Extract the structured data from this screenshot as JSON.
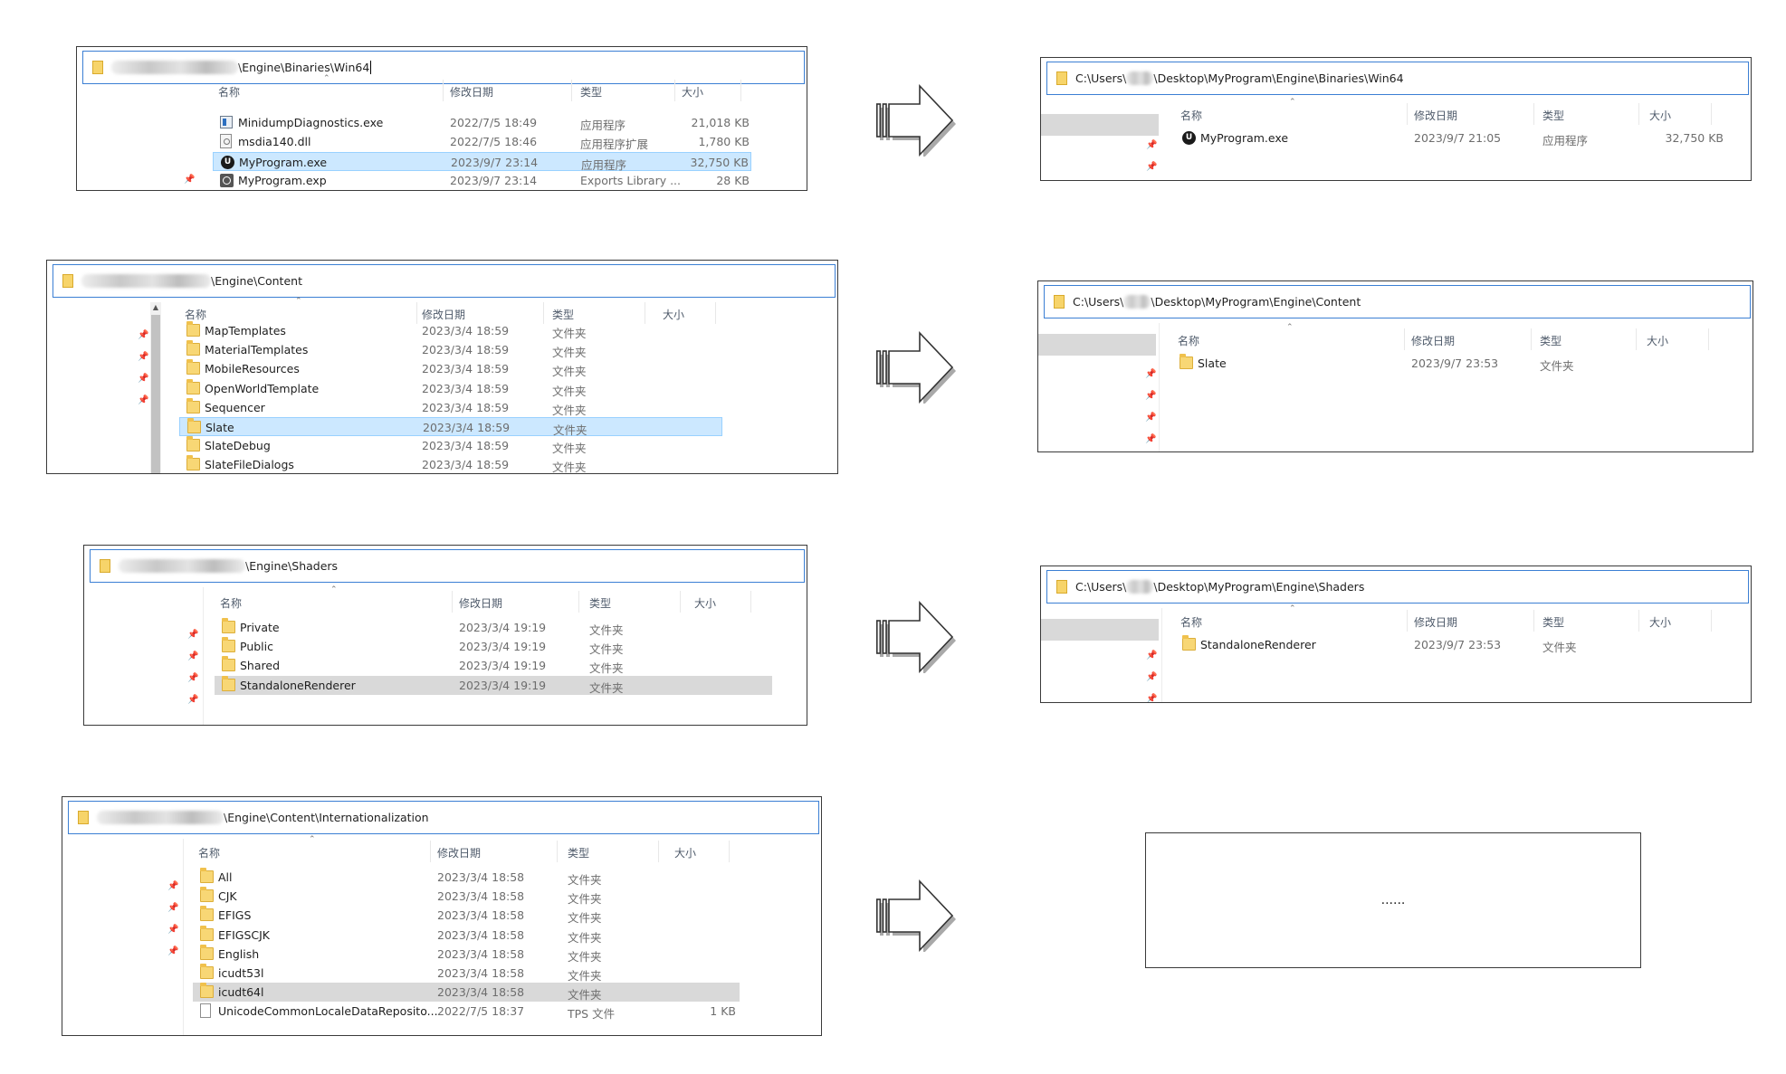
{
  "columns": {
    "name": "名称",
    "date": "修改日期",
    "type": "类型",
    "size": "大小"
  },
  "panels": [
    {
      "id": "p1",
      "path_suffix": "\\Engine\\Binaries\\Win64",
      "rows": [
        {
          "icon": "minidump-app-icon",
          "name": "MinidumpDiagnostics.exe",
          "date": "2022/7/5 18:49",
          "type": "应用程序",
          "size": "21,018 KB"
        },
        {
          "icon": "dll-icon",
          "name": "msdia140.dll",
          "date": "2022/7/5 18:46",
          "type": "应用程序扩展",
          "size": "1,780 KB"
        },
        {
          "icon": "unreal-exe-icon",
          "name": "MyProgram.exe",
          "date": "2023/9/7 23:14",
          "type": "应用程序",
          "size": "32,750 KB"
        },
        {
          "icon": "exp-file-icon",
          "name": "MyProgram.exp",
          "date": "2023/9/7 23:14",
          "type": "Exports Library ...",
          "size": "28 KB"
        }
      ]
    },
    {
      "id": "p2",
      "path_suffix": "\\Engine\\Content",
      "rows": [
        {
          "icon": "folder-icon",
          "name": "MapTemplates",
          "date": "2023/3/4 18:59",
          "type": "文件夹",
          "size": ""
        },
        {
          "icon": "folder-icon",
          "name": "MaterialTemplates",
          "date": "2023/3/4 18:59",
          "type": "文件夹",
          "size": ""
        },
        {
          "icon": "folder-icon",
          "name": "MobileResources",
          "date": "2023/3/4 18:59",
          "type": "文件夹",
          "size": ""
        },
        {
          "icon": "folder-icon",
          "name": "OpenWorldTemplate",
          "date": "2023/3/4 18:59",
          "type": "文件夹",
          "size": ""
        },
        {
          "icon": "folder-icon",
          "name": "Sequencer",
          "date": "2023/3/4 18:59",
          "type": "文件夹",
          "size": ""
        },
        {
          "icon": "folder-icon",
          "name": "Slate",
          "date": "2023/3/4 18:59",
          "type": "文件夹",
          "size": ""
        },
        {
          "icon": "folder-icon",
          "name": "SlateDebug",
          "date": "2023/3/4 18:59",
          "type": "文件夹",
          "size": ""
        },
        {
          "icon": "folder-icon",
          "name": "SlateFileDialogs",
          "date": "2023/3/4 18:59",
          "type": "文件夹",
          "size": ""
        }
      ]
    },
    {
      "id": "p3",
      "path_suffix": "\\Engine\\Shaders",
      "rows": [
        {
          "icon": "folder-icon",
          "name": "Private",
          "date": "2023/3/4 19:19",
          "type": "文件夹",
          "size": ""
        },
        {
          "icon": "folder-icon",
          "name": "Public",
          "date": "2023/3/4 19:19",
          "type": "文件夹",
          "size": ""
        },
        {
          "icon": "folder-icon",
          "name": "Shared",
          "date": "2023/3/4 19:19",
          "type": "文件夹",
          "size": ""
        },
        {
          "icon": "folder-icon",
          "name": "StandaloneRenderer",
          "date": "2023/3/4 19:19",
          "type": "文件夹",
          "size": ""
        }
      ]
    },
    {
      "id": "p4",
      "path_suffix": "\\Engine\\Content\\Internationalization",
      "rows": [
        {
          "icon": "folder-icon",
          "name": "All",
          "date": "2023/3/4 18:58",
          "type": "文件夹",
          "size": ""
        },
        {
          "icon": "folder-icon",
          "name": "CJK",
          "date": "2023/3/4 18:58",
          "type": "文件夹",
          "size": ""
        },
        {
          "icon": "folder-icon",
          "name": "EFIGS",
          "date": "2023/3/4 18:58",
          "type": "文件夹",
          "size": ""
        },
        {
          "icon": "folder-icon",
          "name": "EFIGSCJK",
          "date": "2023/3/4 18:58",
          "type": "文件夹",
          "size": ""
        },
        {
          "icon": "folder-icon",
          "name": "English",
          "date": "2023/3/4 18:58",
          "type": "文件夹",
          "size": ""
        },
        {
          "icon": "folder-icon",
          "name": "icudt53l",
          "date": "2023/3/4 18:58",
          "type": "文件夹",
          "size": ""
        },
        {
          "icon": "folder-icon",
          "name": "icudt64l",
          "date": "2023/3/4 18:58",
          "type": "文件夹",
          "size": ""
        },
        {
          "icon": "file-icon",
          "name": "UnicodeCommonLocaleDataReposito...",
          "date": "2022/7/5 18:37",
          "type": "TPS 文件",
          "size": "1 KB"
        }
      ]
    }
  ],
  "results": [
    {
      "id": "r1",
      "path_prefix": "C:\\Users\\",
      "path_suffix": "\\Desktop\\MyProgram\\Engine\\Binaries\\Win64",
      "rows": [
        {
          "icon": "unreal-exe-icon",
          "name": "MyProgram.exe",
          "date": "2023/9/7 21:05",
          "type": "应用程序",
          "size": "32,750 KB"
        }
      ]
    },
    {
      "id": "r2",
      "path_prefix": "C:\\Users\\",
      "path_suffix": "\\Desktop\\MyProgram\\Engine\\Content",
      "rows": [
        {
          "icon": "folder-icon",
          "name": "Slate",
          "date": "2023/9/7 23:53",
          "type": "文件夹",
          "size": ""
        }
      ]
    },
    {
      "id": "r3",
      "path_prefix": "C:\\Users\\",
      "path_suffix": "\\Desktop\\MyProgram\\Engine\\Shaders",
      "rows": [
        {
          "icon": "folder-icon",
          "name": "StandaloneRenderer",
          "date": "2023/9/7 23:53",
          "type": "文件夹",
          "size": ""
        }
      ]
    }
  ],
  "placeholder_text": "......",
  "colors": {
    "selection_blue": "#cce8ff",
    "selection_gray": "#d9d9d9",
    "address_border": "#3b7fd4",
    "folder": "#f8d775"
  }
}
